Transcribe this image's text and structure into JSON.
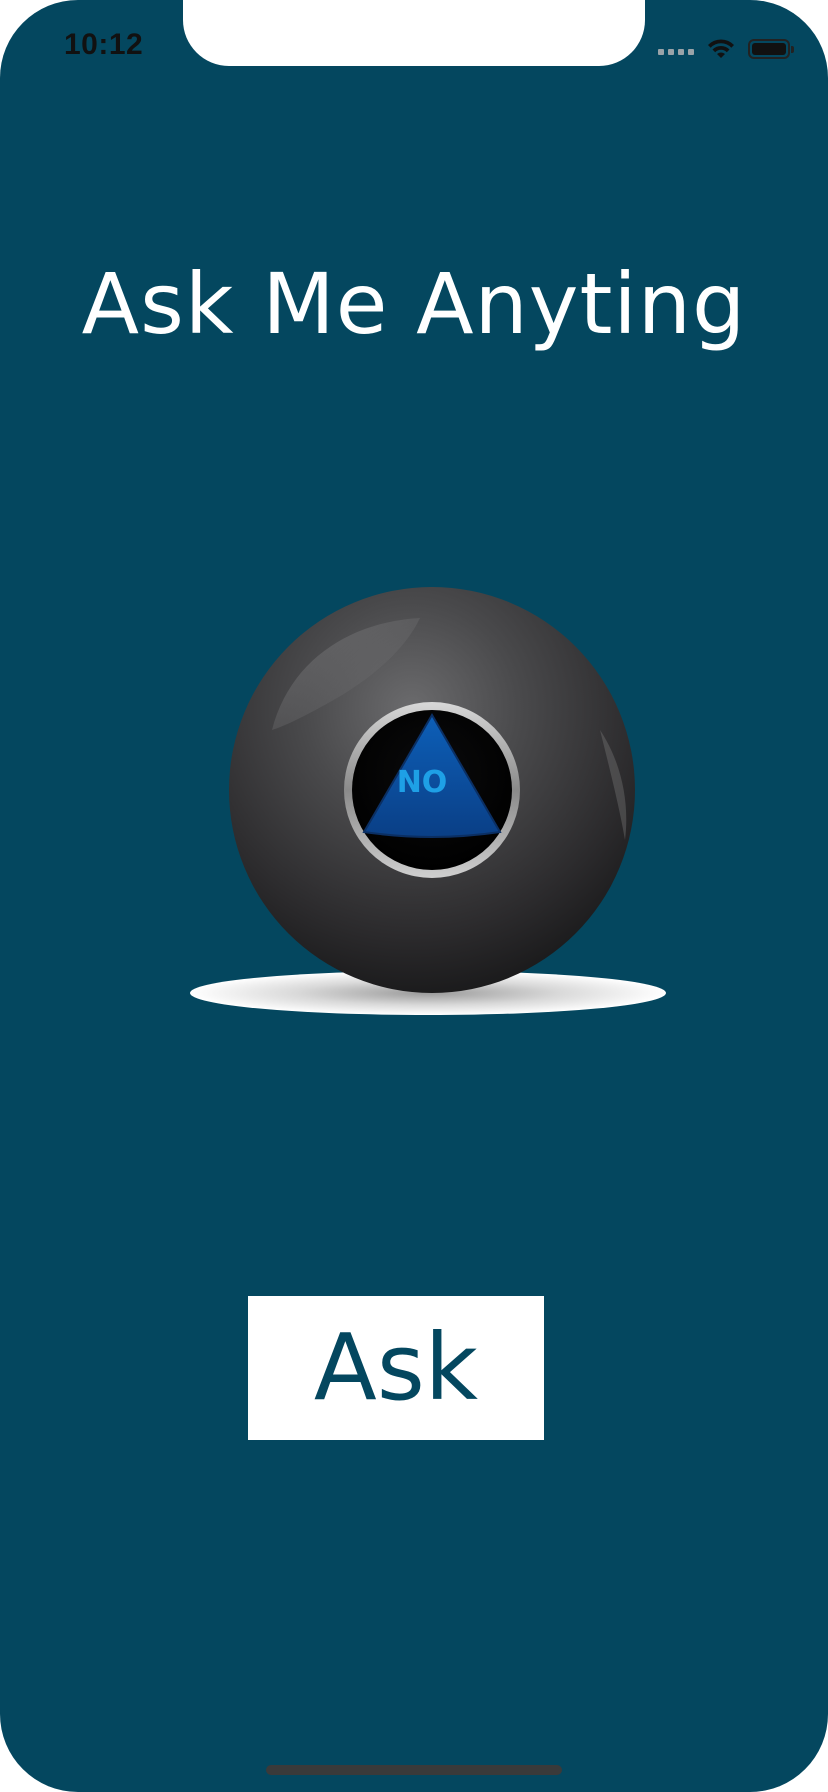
{
  "status_bar": {
    "time": "10:12"
  },
  "title": "Ask Me Anyting",
  "eight_ball": {
    "answer": "NO"
  },
  "ask_button_label": "Ask",
  "colors": {
    "background": "#04475f",
    "title_text": "#ffffff",
    "button_background": "#ffffff",
    "button_text": "#04475f",
    "answer_text": "#1ea0e6"
  }
}
